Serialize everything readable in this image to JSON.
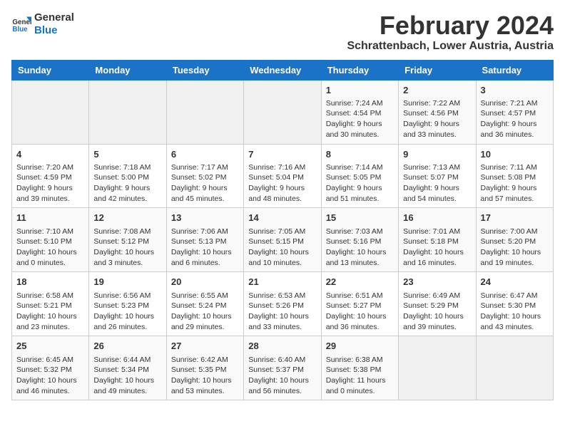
{
  "logo": {
    "line1": "General",
    "line2": "Blue"
  },
  "title": "February 2024",
  "subtitle": "Schrattenbach, Lower Austria, Austria",
  "weekdays": [
    "Sunday",
    "Monday",
    "Tuesday",
    "Wednesday",
    "Thursday",
    "Friday",
    "Saturday"
  ],
  "weeks": [
    [
      {
        "day": "",
        "info": ""
      },
      {
        "day": "",
        "info": ""
      },
      {
        "day": "",
        "info": ""
      },
      {
        "day": "",
        "info": ""
      },
      {
        "day": "1",
        "info": "Sunrise: 7:24 AM\nSunset: 4:54 PM\nDaylight: 9 hours and 30 minutes."
      },
      {
        "day": "2",
        "info": "Sunrise: 7:22 AM\nSunset: 4:56 PM\nDaylight: 9 hours and 33 minutes."
      },
      {
        "day": "3",
        "info": "Sunrise: 7:21 AM\nSunset: 4:57 PM\nDaylight: 9 hours and 36 minutes."
      }
    ],
    [
      {
        "day": "4",
        "info": "Sunrise: 7:20 AM\nSunset: 4:59 PM\nDaylight: 9 hours and 39 minutes."
      },
      {
        "day": "5",
        "info": "Sunrise: 7:18 AM\nSunset: 5:00 PM\nDaylight: 9 hours and 42 minutes."
      },
      {
        "day": "6",
        "info": "Sunrise: 7:17 AM\nSunset: 5:02 PM\nDaylight: 9 hours and 45 minutes."
      },
      {
        "day": "7",
        "info": "Sunrise: 7:16 AM\nSunset: 5:04 PM\nDaylight: 9 hours and 48 minutes."
      },
      {
        "day": "8",
        "info": "Sunrise: 7:14 AM\nSunset: 5:05 PM\nDaylight: 9 hours and 51 minutes."
      },
      {
        "day": "9",
        "info": "Sunrise: 7:13 AM\nSunset: 5:07 PM\nDaylight: 9 hours and 54 minutes."
      },
      {
        "day": "10",
        "info": "Sunrise: 7:11 AM\nSunset: 5:08 PM\nDaylight: 9 hours and 57 minutes."
      }
    ],
    [
      {
        "day": "11",
        "info": "Sunrise: 7:10 AM\nSunset: 5:10 PM\nDaylight: 10 hours and 0 minutes."
      },
      {
        "day": "12",
        "info": "Sunrise: 7:08 AM\nSunset: 5:12 PM\nDaylight: 10 hours and 3 minutes."
      },
      {
        "day": "13",
        "info": "Sunrise: 7:06 AM\nSunset: 5:13 PM\nDaylight: 10 hours and 6 minutes."
      },
      {
        "day": "14",
        "info": "Sunrise: 7:05 AM\nSunset: 5:15 PM\nDaylight: 10 hours and 10 minutes."
      },
      {
        "day": "15",
        "info": "Sunrise: 7:03 AM\nSunset: 5:16 PM\nDaylight: 10 hours and 13 minutes."
      },
      {
        "day": "16",
        "info": "Sunrise: 7:01 AM\nSunset: 5:18 PM\nDaylight: 10 hours and 16 minutes."
      },
      {
        "day": "17",
        "info": "Sunrise: 7:00 AM\nSunset: 5:20 PM\nDaylight: 10 hours and 19 minutes."
      }
    ],
    [
      {
        "day": "18",
        "info": "Sunrise: 6:58 AM\nSunset: 5:21 PM\nDaylight: 10 hours and 23 minutes."
      },
      {
        "day": "19",
        "info": "Sunrise: 6:56 AM\nSunset: 5:23 PM\nDaylight: 10 hours and 26 minutes."
      },
      {
        "day": "20",
        "info": "Sunrise: 6:55 AM\nSunset: 5:24 PM\nDaylight: 10 hours and 29 minutes."
      },
      {
        "day": "21",
        "info": "Sunrise: 6:53 AM\nSunset: 5:26 PM\nDaylight: 10 hours and 33 minutes."
      },
      {
        "day": "22",
        "info": "Sunrise: 6:51 AM\nSunset: 5:27 PM\nDaylight: 10 hours and 36 minutes."
      },
      {
        "day": "23",
        "info": "Sunrise: 6:49 AM\nSunset: 5:29 PM\nDaylight: 10 hours and 39 minutes."
      },
      {
        "day": "24",
        "info": "Sunrise: 6:47 AM\nSunset: 5:30 PM\nDaylight: 10 hours and 43 minutes."
      }
    ],
    [
      {
        "day": "25",
        "info": "Sunrise: 6:45 AM\nSunset: 5:32 PM\nDaylight: 10 hours and 46 minutes."
      },
      {
        "day": "26",
        "info": "Sunrise: 6:44 AM\nSunset: 5:34 PM\nDaylight: 10 hours and 49 minutes."
      },
      {
        "day": "27",
        "info": "Sunrise: 6:42 AM\nSunset: 5:35 PM\nDaylight: 10 hours and 53 minutes."
      },
      {
        "day": "28",
        "info": "Sunrise: 6:40 AM\nSunset: 5:37 PM\nDaylight: 10 hours and 56 minutes."
      },
      {
        "day": "29",
        "info": "Sunrise: 6:38 AM\nSunset: 5:38 PM\nDaylight: 11 hours and 0 minutes."
      },
      {
        "day": "",
        "info": ""
      },
      {
        "day": "",
        "info": ""
      }
    ]
  ]
}
